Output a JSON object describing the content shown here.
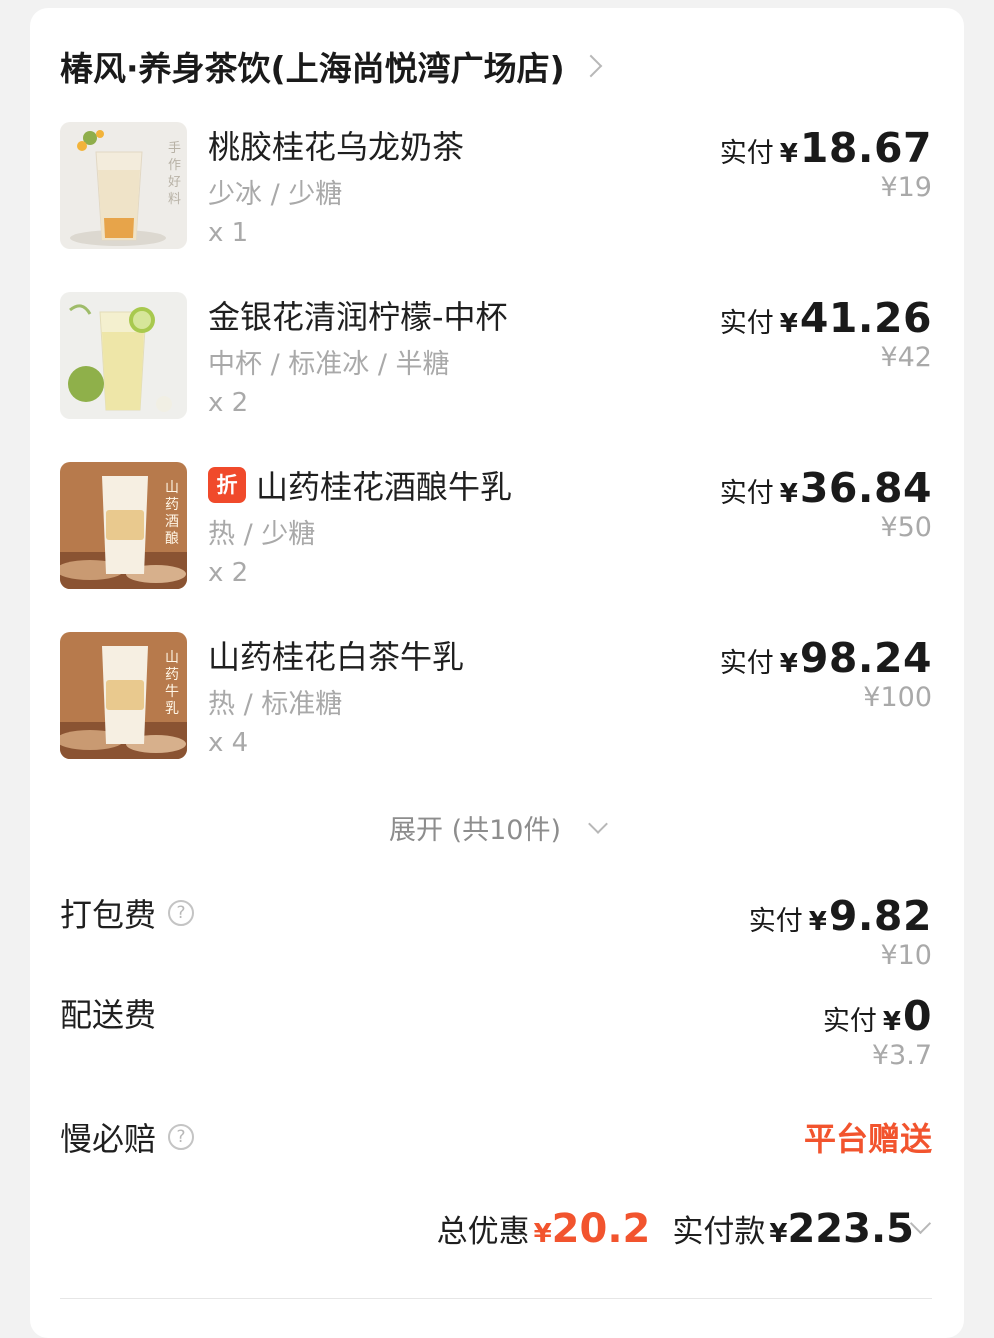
{
  "store": {
    "name": "椿风·养身茶饮(上海尚悦湾广场店)"
  },
  "items": [
    {
      "name": "桃胶桂花乌龙奶茶",
      "spec": "少冰 / 少糖",
      "qty": "x 1",
      "paid_label": "实付",
      "currency": "¥",
      "paid_amount": "18.67",
      "original_price": "¥19",
      "badge": "",
      "thumb_text": "手作好料"
    },
    {
      "name": "金银花清润柠檬-中杯",
      "spec": "中杯 / 标准冰 / 半糖",
      "qty": "x 2",
      "paid_label": "实付",
      "currency": "¥",
      "paid_amount": "41.26",
      "original_price": "¥42",
      "badge": "",
      "thumb_text": ""
    },
    {
      "name": "山药桂花酒酿牛乳",
      "spec": "热 / 少糖",
      "qty": "x 2",
      "paid_label": "实付",
      "currency": "¥",
      "paid_amount": "36.84",
      "original_price": "¥50",
      "badge": "折",
      "thumb_text": "山药酒酿"
    },
    {
      "name": "山药桂花白茶牛乳",
      "spec": "热 / 标准糖",
      "qty": "x 4",
      "paid_label": "实付",
      "currency": "¥",
      "paid_amount": "98.24",
      "original_price": "¥100",
      "badge": "",
      "thumb_text": "山药牛乳"
    }
  ],
  "expand": {
    "label": "展开 (共10件)"
  },
  "fees": {
    "packing": {
      "label": "打包费",
      "paid_label": "实付",
      "currency": "¥",
      "paid_amount": "9.82",
      "original_price": "¥10",
      "help_icon": "question-circle-icon"
    },
    "delivery": {
      "label": "配送费",
      "paid_label": "实付",
      "currency": "¥",
      "paid_amount": "0",
      "original_price": "¥3.7"
    },
    "slow_comp": {
      "label": "慢必赔",
      "value": "平台赠送",
      "help_icon": "question-circle-icon"
    }
  },
  "summary": {
    "discount_label": "总优惠",
    "discount_currency": "¥",
    "discount_amount": "20.2",
    "paid_label": "实付款",
    "paid_currency": "¥",
    "paid_amount": "223.5"
  },
  "colors": {
    "accent": "#f2542e",
    "muted": "#a9a9a9",
    "badge": "#f04a2b"
  }
}
